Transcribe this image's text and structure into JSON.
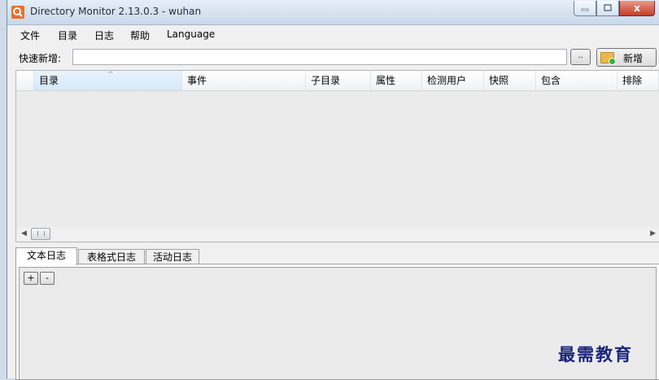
{
  "window": {
    "title": "Directory Monitor 2.13.0.3 - wuhan",
    "app_icon": "search-magnifier-icon",
    "controls": [
      "minimize-icon",
      "maximize-icon",
      "close-icon"
    ],
    "close_glyph": "x"
  },
  "menu": {
    "items": [
      {
        "label": "文件"
      },
      {
        "label": "目录"
      },
      {
        "label": "日志"
      },
      {
        "label": "帮助"
      },
      {
        "label": "Language"
      }
    ]
  },
  "quick_add": {
    "label": "快速新增:",
    "input_value": "",
    "browse_label": "..",
    "add_label": "新增",
    "add_icon": "folder-add-icon"
  },
  "grid": {
    "columns": [
      {
        "label": "目录",
        "sorted": true
      },
      {
        "label": "事件"
      },
      {
        "label": "子目录"
      },
      {
        "label": "属性"
      },
      {
        "label": "检测用户"
      },
      {
        "label": "快照"
      },
      {
        "label": "包含"
      },
      {
        "label": "排除"
      }
    ],
    "rows": [],
    "sort_indicator": "^",
    "scroll_left": "◀",
    "scroll_right": "▶"
  },
  "log_tabs": [
    {
      "label": "文本日志",
      "active": true
    },
    {
      "label": "表格式日志"
    },
    {
      "label": "活动日志"
    }
  ],
  "log_buttons": {
    "expand": "+",
    "collapse": "-"
  },
  "watermark": "最需教育",
  "colors": {
    "title_gradient_top": "#e6eef8",
    "close_button": "#c63d25",
    "app_icon": "#e8712b",
    "watermark": "#1a237e"
  }
}
